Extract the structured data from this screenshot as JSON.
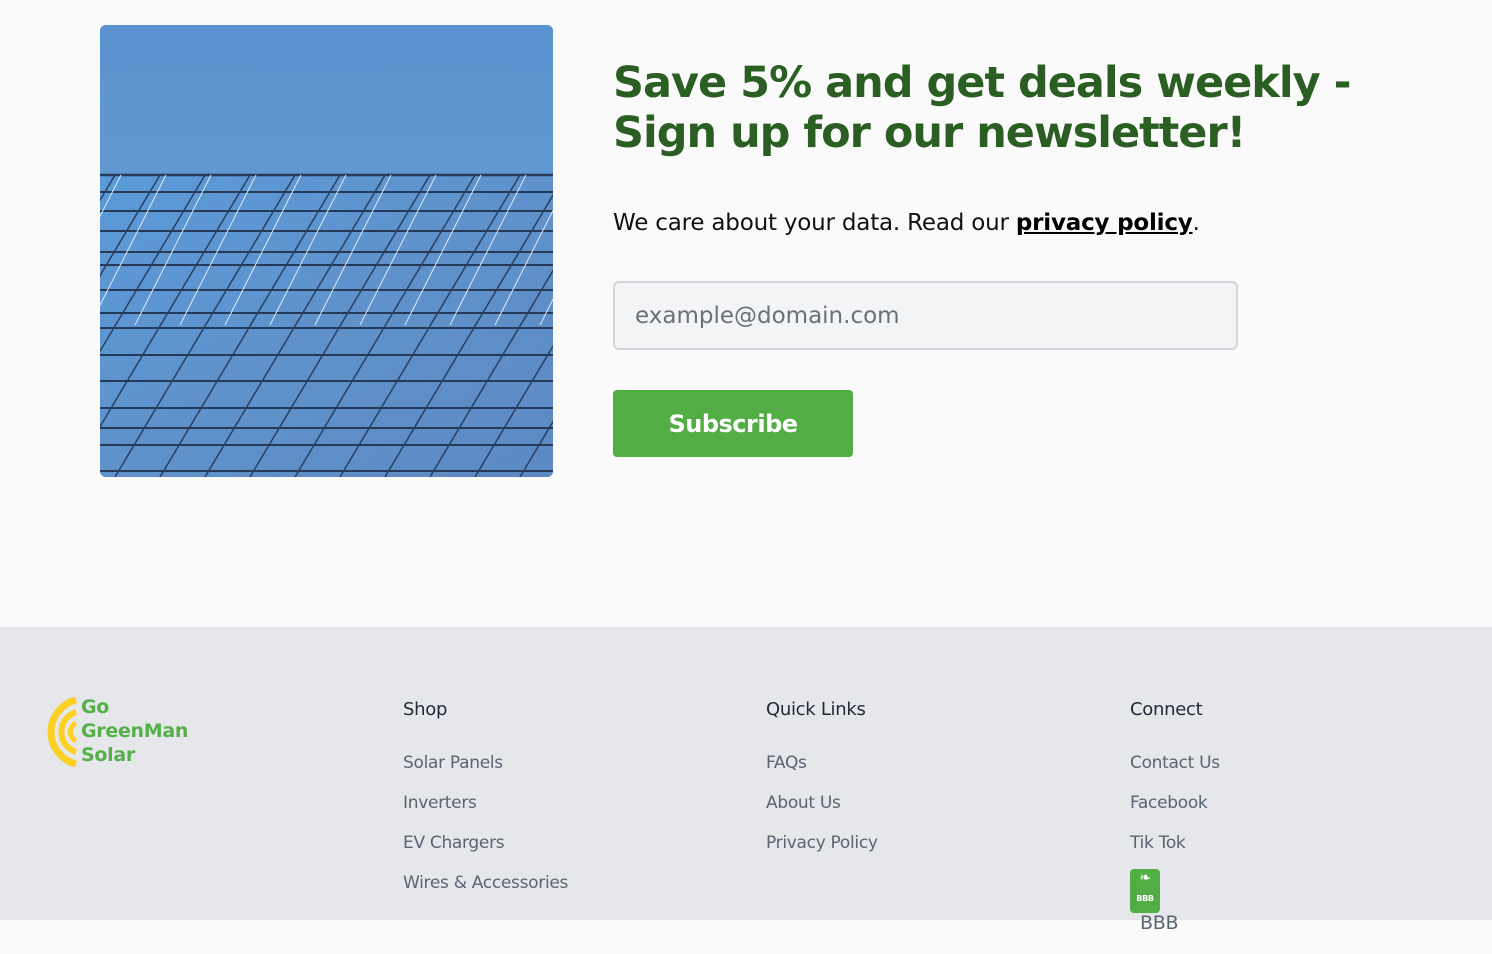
{
  "newsletter": {
    "headline": "Save 5% and get deals weekly - Sign up for our newsletter!",
    "data_note_prefix": "We care about your data. Read our ",
    "privacy_link": "privacy policy",
    "data_note_suffix": ".",
    "email_placeholder": "example@domain.com",
    "subscribe_label": "Subscribe"
  },
  "brand": {
    "logo_lines": [
      "Go",
      "GreenMan",
      "Solar"
    ],
    "green": "#52ae44",
    "yellow": "#fdd023",
    "headline_green": "#2b5e22"
  },
  "footer": {
    "shop": {
      "title": "Shop",
      "links": [
        "Solar Panels",
        "Inverters",
        "EV Chargers",
        "Wires & Accessories"
      ]
    },
    "quick_links": {
      "title": "Quick Links",
      "links": [
        "FAQs",
        "About Us",
        "Privacy Policy"
      ]
    },
    "connect": {
      "title": "Connect",
      "links": [
        "Contact Us",
        "Facebook",
        "Tik Tok"
      ],
      "bbb_badge_text": "BBB",
      "bbb_label": "BBB"
    }
  }
}
